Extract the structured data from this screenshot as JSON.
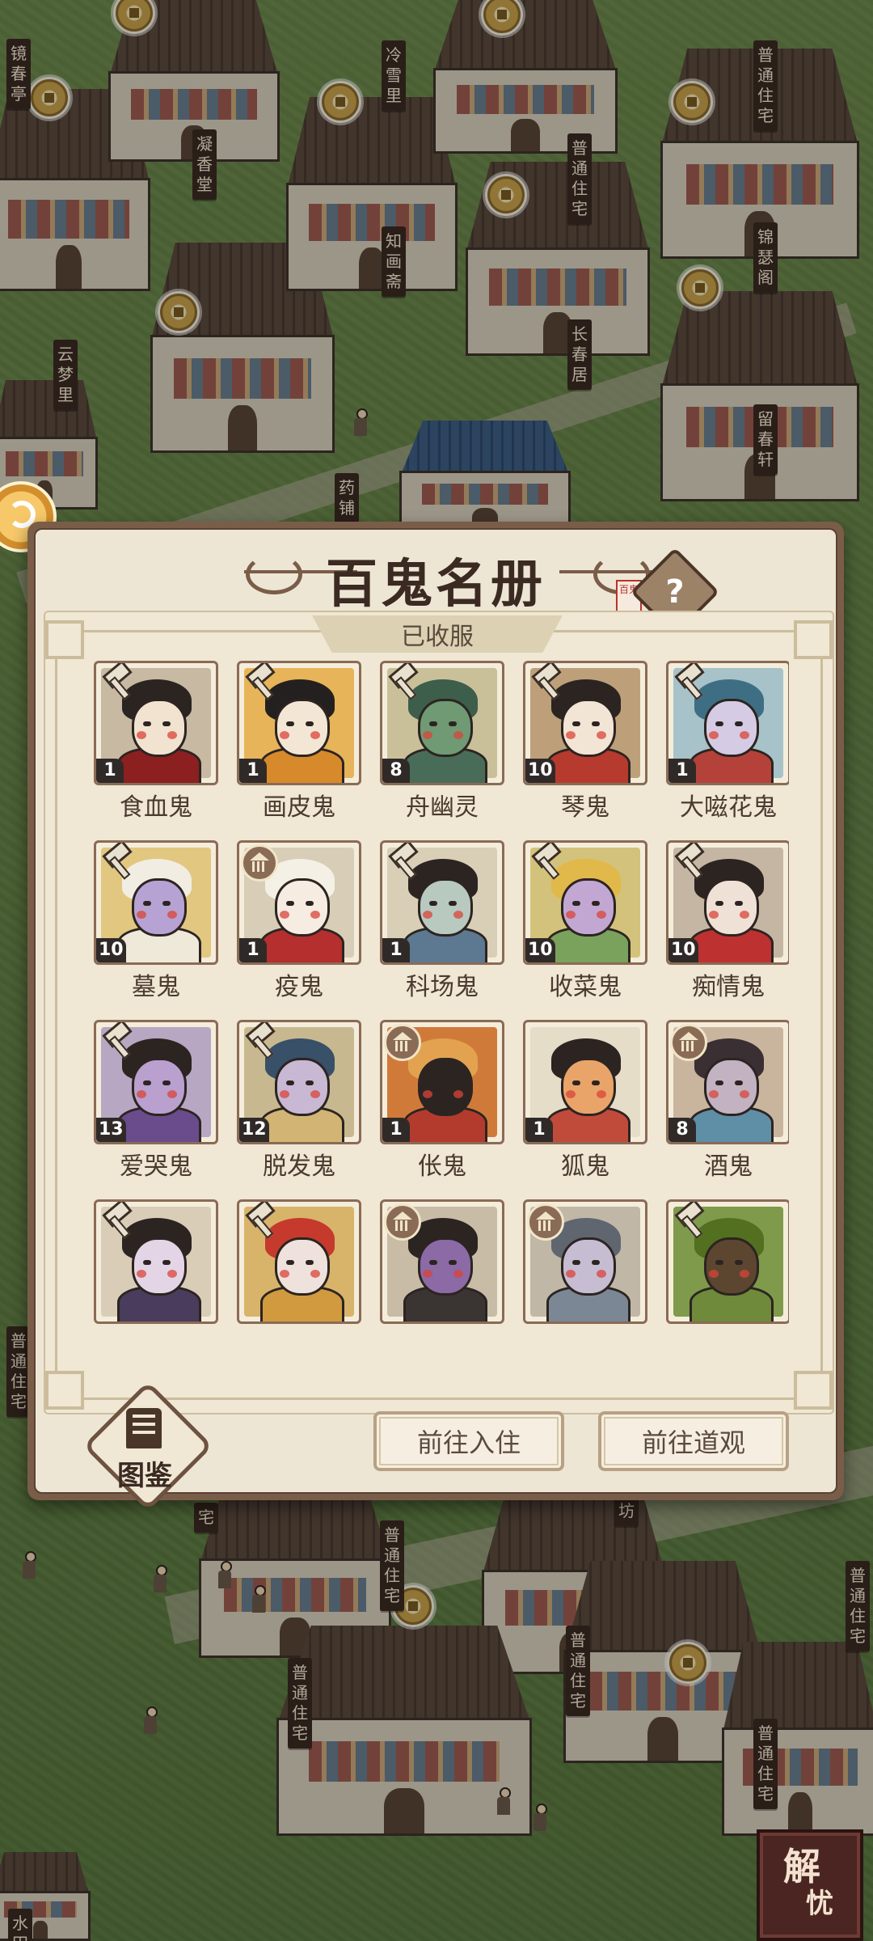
{
  "dialog": {
    "title": "百鬼名册",
    "seal_text": "百鬼",
    "help_icon": "?",
    "section_label": "已收服",
    "tujian_label": "图鉴",
    "btn_go_live": "前往入住",
    "btn_go_temple": "前往道观"
  },
  "ghosts": [
    {
      "name": "食血鬼",
      "level": "1",
      "badge": "hammer",
      "palette": {
        "bg": "#c7b9a2",
        "face": "#f1e3cf",
        "hair": "#2c2421",
        "body": "#8c1f1f"
      }
    },
    {
      "name": "画皮鬼",
      "level": "1",
      "badge": "hammer",
      "palette": {
        "bg": "#e7b45a",
        "face": "#f4e6d4",
        "hair": "#242020",
        "body": "#d78a2b"
      }
    },
    {
      "name": "舟幽灵",
      "level": "8",
      "badge": "hammer",
      "palette": {
        "bg": "#c9c09a",
        "face": "#6f9a74",
        "hair": "#3d5e4b",
        "body": "#496c58"
      }
    },
    {
      "name": "琴鬼",
      "level": "10",
      "badge": "hammer",
      "palette": {
        "bg": "#bda07a",
        "face": "#f3e5d5",
        "hair": "#2c2421",
        "body": "#b73a2e"
      }
    },
    {
      "name": "大嗞花鬼",
      "level": "1",
      "badge": "hammer",
      "palette": {
        "bg": "#a7c2c8",
        "face": "#d6cbe4",
        "hair": "#3e6e84",
        "body": "#b5423a"
      }
    },
    {
      "name": "墓鬼",
      "level": "10",
      "badge": "hammer",
      "palette": {
        "bg": "#e1c780",
        "face": "#b6a3d3",
        "hair": "#f2ede2",
        "body": "#efe9da"
      }
    },
    {
      "name": "疫鬼",
      "level": "1",
      "badge": "building",
      "palette": {
        "bg": "#d8cdb6",
        "face": "#f7ece2",
        "hair": "#f4f0e6",
        "body": "#b52f2f"
      }
    },
    {
      "name": "科场鬼",
      "level": "1",
      "badge": "hammer",
      "palette": {
        "bg": "#d9cfb7",
        "face": "#b8c9c0",
        "hair": "#2c2421",
        "body": "#5d7891"
      }
    },
    {
      "name": "收菜鬼",
      "level": "10",
      "badge": "hammer",
      "palette": {
        "bg": "#d3c27c",
        "face": "#c3a7d3",
        "hair": "#e1b84a",
        "body": "#7aa25c"
      }
    },
    {
      "name": "痴情鬼",
      "level": "10",
      "badge": "hammer",
      "palette": {
        "bg": "#c4b6a2",
        "face": "#f0e1d6",
        "hair": "#2c2421",
        "body": "#be3131"
      }
    },
    {
      "name": "爱哭鬼",
      "level": "13",
      "badge": "hammer",
      "palette": {
        "bg": "#b7a7c2",
        "face": "#b9a0cf",
        "hair": "#2c2421",
        "body": "#6a4c8c"
      }
    },
    {
      "name": "脱发鬼",
      "level": "12",
      "badge": "hammer",
      "palette": {
        "bg": "#c7b88f",
        "face": "#c8b8d4",
        "hair": "#385068",
        "body": "#d2b574"
      }
    },
    {
      "name": "伥鬼",
      "level": "1",
      "badge": "building",
      "palette": {
        "bg": "#d07a3a",
        "face": "#2c2421",
        "hair": "#e3a24f",
        "body": "#b33b2e"
      }
    },
    {
      "name": "狐鬼",
      "level": "1",
      "badge": "none",
      "palette": {
        "bg": "#e6ddc9",
        "face": "#e9a46a",
        "hair": "#2c2421",
        "body": "#c14b3b"
      }
    },
    {
      "name": "酒鬼",
      "level": "8",
      "badge": "building",
      "palette": {
        "bg": "#c9b59e",
        "face": "#c2b2c2",
        "hair": "#3a2f33",
        "body": "#5f8fa7"
      }
    },
    {
      "name": "",
      "level": "",
      "badge": "hammer",
      "palette": {
        "bg": "#d9cdb8",
        "face": "#e4d5e6",
        "hair": "#2c2421",
        "body": "#4a3c5c"
      }
    },
    {
      "name": "",
      "level": "",
      "badge": "hammer",
      "palette": {
        "bg": "#d8b36a",
        "face": "#efe2dc",
        "hair": "#c53a2c",
        "body": "#d19a3f"
      }
    },
    {
      "name": "",
      "level": "",
      "badge": "building",
      "palette": {
        "bg": "#c8bca7",
        "face": "#8b6aa6",
        "hair": "#2c2421",
        "body": "#3a3433"
      }
    },
    {
      "name": "",
      "level": "",
      "badge": "building",
      "palette": {
        "bg": "#c0b7a6",
        "face": "#c6bdd3",
        "hair": "#5f6670",
        "body": "#7b8794"
      }
    },
    {
      "name": "",
      "level": "",
      "badge": "hammer",
      "palette": {
        "bg": "#7e9a4a",
        "face": "#5d4630",
        "hair": "#52701f",
        "body": "#6e8a3a"
      }
    }
  ],
  "town_signs": [
    {
      "text": "镜春亭"
    },
    {
      "text": "冷雪里"
    },
    {
      "text": "普通住宅"
    },
    {
      "text": "凝香堂"
    },
    {
      "text": "普通住宅"
    },
    {
      "text": "知画斋"
    },
    {
      "text": "锦瑟阁"
    },
    {
      "text": "云梦里"
    },
    {
      "text": "长春居"
    },
    {
      "text": "留春轩"
    },
    {
      "text": "药铺"
    },
    {
      "text": "普通住宅"
    },
    {
      "text": "普通住宅"
    },
    {
      "text": "坊"
    },
    {
      "text": "普通住宅"
    },
    {
      "text": "普通住宅"
    },
    {
      "text": "普通住宅"
    },
    {
      "text": "普通住宅"
    },
    {
      "text": "水田"
    },
    {
      "text": "宅"
    }
  ],
  "jieyou": {
    "char1": "解",
    "char2": "忧"
  },
  "colors": {
    "panel_bg": "#eee6d5",
    "frame": "#7a5d48",
    "accent_red": "#b7342c"
  }
}
